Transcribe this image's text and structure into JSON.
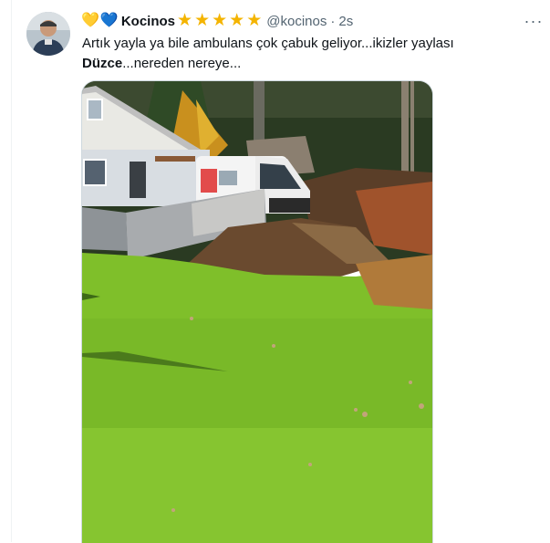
{
  "tweet": {
    "author": {
      "name_prefix_emojis": [
        "💛",
        "💙"
      ],
      "display_name": "Kocinos",
      "badge_stars": [
        "★",
        "★",
        "★",
        "★",
        "★"
      ],
      "handle": "@kocinos",
      "separator": "·",
      "time": "2s"
    },
    "more_label": "···",
    "text": {
      "line1": "Artık yayla ya bile ambulans çok çabuk geliyor...ikizler yaylası",
      "bold": "Düzce",
      "line2_rest": "...nereden nereye..."
    },
    "media": {
      "description_icon": "photo",
      "alt": ""
    }
  },
  "colors": {
    "text_primary": "#0f1419",
    "text_secondary": "#536471",
    "star": "#f4b400",
    "border": "#cfd9de"
  }
}
